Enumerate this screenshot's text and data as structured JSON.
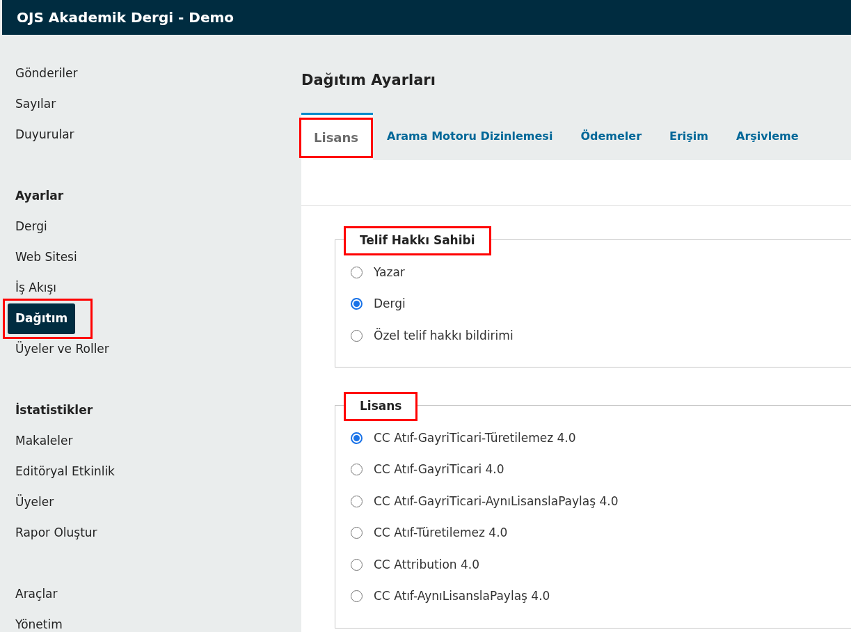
{
  "header": {
    "title": "OJS Akademik Dergi - Demo"
  },
  "sidebar": {
    "groups": [
      {
        "items": [
          {
            "label": "Gönderiler",
            "selected": false,
            "highlighted": false
          },
          {
            "label": "Sayılar",
            "selected": false,
            "highlighted": false
          },
          {
            "label": "Duyurular",
            "selected": false,
            "highlighted": false
          }
        ]
      },
      {
        "heading": "Ayarlar",
        "items": [
          {
            "label": "Dergi",
            "selected": false,
            "highlighted": false
          },
          {
            "label": "Web Sitesi",
            "selected": false,
            "highlighted": false
          },
          {
            "label": "İş Akışı",
            "selected": false,
            "highlighted": false
          },
          {
            "label": "Dağıtım",
            "selected": true,
            "highlighted": true
          },
          {
            "label": "Üyeler ve Roller",
            "selected": false,
            "highlighted": false
          }
        ]
      },
      {
        "heading": "İstatistikler",
        "items": [
          {
            "label": "Makaleler",
            "selected": false,
            "highlighted": false
          },
          {
            "label": "Editöryal Etkinlik",
            "selected": false,
            "highlighted": false
          },
          {
            "label": "Üyeler",
            "selected": false,
            "highlighted": false
          },
          {
            "label": "Rapor Oluştur",
            "selected": false,
            "highlighted": false
          }
        ]
      },
      {
        "items": [
          {
            "label": "Araçlar",
            "selected": false,
            "highlighted": false
          },
          {
            "label": "Yönetim",
            "selected": false,
            "highlighted": false
          }
        ]
      }
    ]
  },
  "page_title": "Dağıtım Ayarları",
  "tabs": [
    {
      "label": "Lisans",
      "selected": true,
      "highlighted": true
    },
    {
      "label": "Arama Motoru Dizinlemesi",
      "selected": false,
      "highlighted": false
    },
    {
      "label": "Ödemeler",
      "selected": false,
      "highlighted": false
    },
    {
      "label": "Erişim",
      "selected": false,
      "highlighted": false
    },
    {
      "label": "Arşivleme",
      "selected": false,
      "highlighted": false
    }
  ],
  "fieldsets": [
    {
      "legend": "Telif Hakkı Sahibi",
      "highlighted": true,
      "options": [
        {
          "label": "Yazar",
          "selected": false
        },
        {
          "label": "Dergi",
          "selected": true
        },
        {
          "label": "Özel telif hakkı bildirimi",
          "selected": false
        }
      ]
    },
    {
      "legend": "Lisans",
      "highlighted": true,
      "options": [
        {
          "label": "CC Atıf-GayriTicari-Türetilemez 4.0",
          "selected": true
        },
        {
          "label": "CC Atıf-GayriTicari 4.0",
          "selected": false
        },
        {
          "label": "CC Atıf-GayriTicari-AynıLisanslaPaylaş 4.0",
          "selected": false
        },
        {
          "label": "CC Atıf-Türetilemez 4.0",
          "selected": false
        },
        {
          "label": "CC Attribution 4.0",
          "selected": false
        },
        {
          "label": "CC Atıf-AynıLisanslaPaylaş 4.0",
          "selected": false
        }
      ]
    }
  ]
}
